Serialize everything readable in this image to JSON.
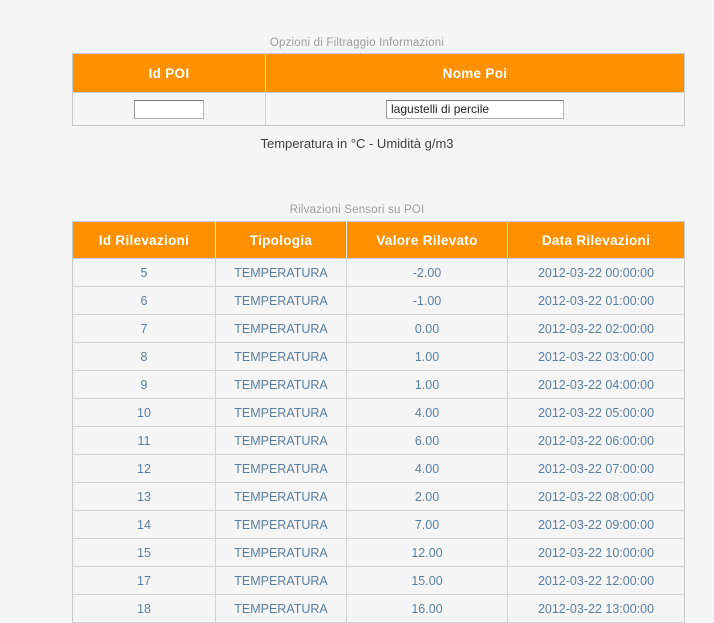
{
  "filter_section": {
    "caption": "Opzioni di Filtraggio Informazioni",
    "columns": [
      "Id POI",
      "Nome Poi"
    ],
    "fields": {
      "id_poi": {
        "label": "Id POI",
        "value": "",
        "placeholder": ""
      },
      "nome_poi": {
        "label": "Nome Poi",
        "value": "lagustelli di percile",
        "placeholder": ""
      }
    }
  },
  "legend": {
    "text": "Temperatura in °C - Umidità g/m3"
  },
  "readings_section": {
    "caption": "Rilvazioni Sensori su POI",
    "columns": [
      "Id Rilevazioni",
      "Tipologia",
      "Valore Rilevato",
      "Data Rilevazioni"
    ],
    "rows": [
      {
        "id": "5",
        "tipologia": "TEMPERATURA",
        "valore": "-2.00",
        "data": "2012-03-22 00:00:00"
      },
      {
        "id": "6",
        "tipologia": "TEMPERATURA",
        "valore": "-1.00",
        "data": "2012-03-22 01:00:00"
      },
      {
        "id": "7",
        "tipologia": "TEMPERATURA",
        "valore": "0.00",
        "data": "2012-03-22 02:00:00"
      },
      {
        "id": "8",
        "tipologia": "TEMPERATURA",
        "valore": "1.00",
        "data": "2012-03-22 03:00:00"
      },
      {
        "id": "9",
        "tipologia": "TEMPERATURA",
        "valore": "1.00",
        "data": "2012-03-22 04:00:00"
      },
      {
        "id": "10",
        "tipologia": "TEMPERATURA",
        "valore": "4.00",
        "data": "2012-03-22 05:00:00"
      },
      {
        "id": "11",
        "tipologia": "TEMPERATURA",
        "valore": "6.00",
        "data": "2012-03-22 06:00:00"
      },
      {
        "id": "12",
        "tipologia": "TEMPERATURA",
        "valore": "4.00",
        "data": "2012-03-22 07:00:00"
      },
      {
        "id": "13",
        "tipologia": "TEMPERATURA",
        "valore": "2.00",
        "data": "2012-03-22 08:00:00"
      },
      {
        "id": "14",
        "tipologia": "TEMPERATURA",
        "valore": "7.00",
        "data": "2012-03-22 09:00:00"
      },
      {
        "id": "15",
        "tipologia": "TEMPERATURA",
        "valore": "12.00",
        "data": "2012-03-22 10:00:00"
      },
      {
        "id": "17",
        "tipologia": "TEMPERATURA",
        "valore": "15.00",
        "data": "2012-03-22 12:00:00"
      },
      {
        "id": "18",
        "tipologia": "TEMPERATURA",
        "valore": "16.00",
        "data": "2012-03-22 13:00:00"
      }
    ]
  },
  "colors": {
    "header_orange": "#ff9000",
    "header_text": "#ffffff",
    "cell_text": "#5c7f9e",
    "caption_text": "#9d9d9d",
    "page_background": "#f5f5f5",
    "border": "#d2d2d2"
  }
}
